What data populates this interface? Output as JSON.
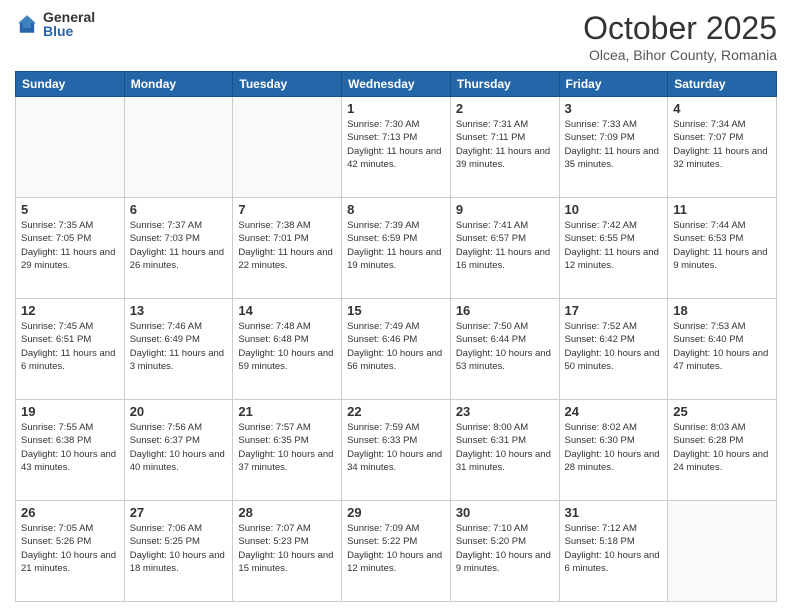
{
  "header": {
    "logo_general": "General",
    "logo_blue": "Blue",
    "month": "October 2025",
    "location": "Olcea, Bihor County, Romania"
  },
  "weekdays": [
    "Sunday",
    "Monday",
    "Tuesday",
    "Wednesday",
    "Thursday",
    "Friday",
    "Saturday"
  ],
  "weeks": [
    [
      {
        "day": "",
        "info": ""
      },
      {
        "day": "",
        "info": ""
      },
      {
        "day": "",
        "info": ""
      },
      {
        "day": "1",
        "info": "Sunrise: 7:30 AM\nSunset: 7:13 PM\nDaylight: 11 hours\nand 42 minutes."
      },
      {
        "day": "2",
        "info": "Sunrise: 7:31 AM\nSunset: 7:11 PM\nDaylight: 11 hours\nand 39 minutes."
      },
      {
        "day": "3",
        "info": "Sunrise: 7:33 AM\nSunset: 7:09 PM\nDaylight: 11 hours\nand 35 minutes."
      },
      {
        "day": "4",
        "info": "Sunrise: 7:34 AM\nSunset: 7:07 PM\nDaylight: 11 hours\nand 32 minutes."
      }
    ],
    [
      {
        "day": "5",
        "info": "Sunrise: 7:35 AM\nSunset: 7:05 PM\nDaylight: 11 hours\nand 29 minutes."
      },
      {
        "day": "6",
        "info": "Sunrise: 7:37 AM\nSunset: 7:03 PM\nDaylight: 11 hours\nand 26 minutes."
      },
      {
        "day": "7",
        "info": "Sunrise: 7:38 AM\nSunset: 7:01 PM\nDaylight: 11 hours\nand 22 minutes."
      },
      {
        "day": "8",
        "info": "Sunrise: 7:39 AM\nSunset: 6:59 PM\nDaylight: 11 hours\nand 19 minutes."
      },
      {
        "day": "9",
        "info": "Sunrise: 7:41 AM\nSunset: 6:57 PM\nDaylight: 11 hours\nand 16 minutes."
      },
      {
        "day": "10",
        "info": "Sunrise: 7:42 AM\nSunset: 6:55 PM\nDaylight: 11 hours\nand 12 minutes."
      },
      {
        "day": "11",
        "info": "Sunrise: 7:44 AM\nSunset: 6:53 PM\nDaylight: 11 hours\nand 9 minutes."
      }
    ],
    [
      {
        "day": "12",
        "info": "Sunrise: 7:45 AM\nSunset: 6:51 PM\nDaylight: 11 hours\nand 6 minutes."
      },
      {
        "day": "13",
        "info": "Sunrise: 7:46 AM\nSunset: 6:49 PM\nDaylight: 11 hours\nand 3 minutes."
      },
      {
        "day": "14",
        "info": "Sunrise: 7:48 AM\nSunset: 6:48 PM\nDaylight: 10 hours\nand 59 minutes."
      },
      {
        "day": "15",
        "info": "Sunrise: 7:49 AM\nSunset: 6:46 PM\nDaylight: 10 hours\nand 56 minutes."
      },
      {
        "day": "16",
        "info": "Sunrise: 7:50 AM\nSunset: 6:44 PM\nDaylight: 10 hours\nand 53 minutes."
      },
      {
        "day": "17",
        "info": "Sunrise: 7:52 AM\nSunset: 6:42 PM\nDaylight: 10 hours\nand 50 minutes."
      },
      {
        "day": "18",
        "info": "Sunrise: 7:53 AM\nSunset: 6:40 PM\nDaylight: 10 hours\nand 47 minutes."
      }
    ],
    [
      {
        "day": "19",
        "info": "Sunrise: 7:55 AM\nSunset: 6:38 PM\nDaylight: 10 hours\nand 43 minutes."
      },
      {
        "day": "20",
        "info": "Sunrise: 7:56 AM\nSunset: 6:37 PM\nDaylight: 10 hours\nand 40 minutes."
      },
      {
        "day": "21",
        "info": "Sunrise: 7:57 AM\nSunset: 6:35 PM\nDaylight: 10 hours\nand 37 minutes."
      },
      {
        "day": "22",
        "info": "Sunrise: 7:59 AM\nSunset: 6:33 PM\nDaylight: 10 hours\nand 34 minutes."
      },
      {
        "day": "23",
        "info": "Sunrise: 8:00 AM\nSunset: 6:31 PM\nDaylight: 10 hours\nand 31 minutes."
      },
      {
        "day": "24",
        "info": "Sunrise: 8:02 AM\nSunset: 6:30 PM\nDaylight: 10 hours\nand 28 minutes."
      },
      {
        "day": "25",
        "info": "Sunrise: 8:03 AM\nSunset: 6:28 PM\nDaylight: 10 hours\nand 24 minutes."
      }
    ],
    [
      {
        "day": "26",
        "info": "Sunrise: 7:05 AM\nSunset: 5:26 PM\nDaylight: 10 hours\nand 21 minutes."
      },
      {
        "day": "27",
        "info": "Sunrise: 7:06 AM\nSunset: 5:25 PM\nDaylight: 10 hours\nand 18 minutes."
      },
      {
        "day": "28",
        "info": "Sunrise: 7:07 AM\nSunset: 5:23 PM\nDaylight: 10 hours\nand 15 minutes."
      },
      {
        "day": "29",
        "info": "Sunrise: 7:09 AM\nSunset: 5:22 PM\nDaylight: 10 hours\nand 12 minutes."
      },
      {
        "day": "30",
        "info": "Sunrise: 7:10 AM\nSunset: 5:20 PM\nDaylight: 10 hours\nand 9 minutes."
      },
      {
        "day": "31",
        "info": "Sunrise: 7:12 AM\nSunset: 5:18 PM\nDaylight: 10 hours\nand 6 minutes."
      },
      {
        "day": "",
        "info": ""
      }
    ]
  ]
}
